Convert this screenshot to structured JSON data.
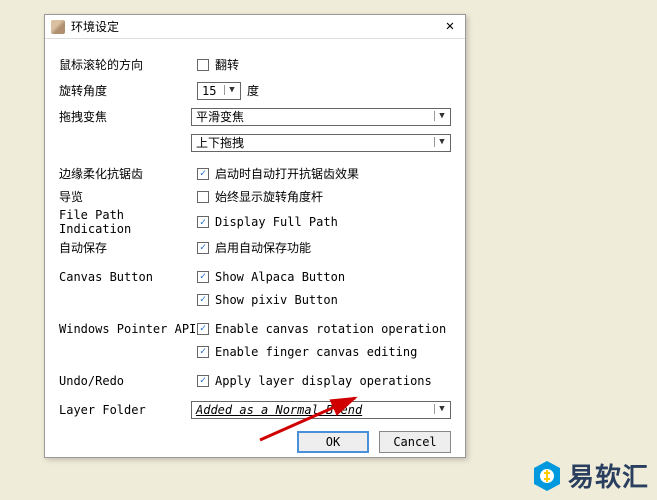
{
  "titlebar": {
    "title": "环境设定",
    "close": "✕"
  },
  "rows": {
    "wheelDir": {
      "label": "鼠标滚轮的方向",
      "cb": "翻转",
      "checked": false
    },
    "rotateAngle": {
      "label": "旋转角度",
      "value": "15",
      "unit": "度"
    },
    "dragZoom": {
      "label": "拖拽变焦",
      "value1": "平滑变焦",
      "value2": "上下拖拽"
    },
    "antialias": {
      "label": "边缘柔化抗锯齿",
      "cb": "启动时自动打开抗锯齿效果",
      "checked": true
    },
    "nav": {
      "label": "导览",
      "cb": "始终显示旋转角度杆",
      "checked": false
    },
    "filepath": {
      "label": "File Path Indication",
      "cb": "Display Full Path",
      "checked": true
    },
    "autosave": {
      "label": "自动保存",
      "cb": "启用自动保存功能",
      "checked": true
    },
    "canvasBtn1": {
      "label": "Canvas Button",
      "cb": "Show Alpaca Button",
      "checked": true
    },
    "canvasBtn2": {
      "label": "",
      "cb": "Show pixiv Button",
      "checked": true
    },
    "winPtr1": {
      "label": "Windows Pointer API",
      "cb": "Enable canvas rotation operation",
      "checked": true
    },
    "winPtr2": {
      "label": "",
      "cb": "Enable finger canvas editing",
      "checked": true
    },
    "undoredo": {
      "label": "Undo/Redo",
      "cb": "Apply layer display operations",
      "checked": true
    },
    "layerFolder": {
      "label": "Layer Folder",
      "value": "Added as a Normal Blend"
    }
  },
  "buttons": {
    "ok": "OK",
    "cancel": "Cancel"
  },
  "brand": {
    "text": "易软汇"
  }
}
